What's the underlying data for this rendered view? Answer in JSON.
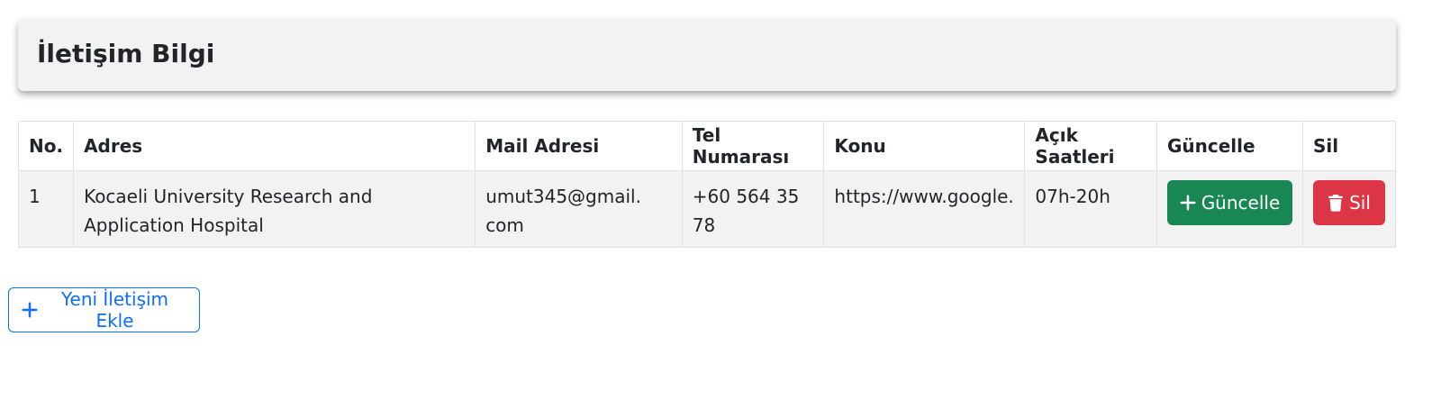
{
  "header": {
    "title": "İletişim Bilgi"
  },
  "table": {
    "columns": [
      "No.",
      "Adres",
      "Mail Adresi",
      "Tel Numarası",
      "Konu",
      "Açık Saatleri",
      "Güncelle",
      "Sil"
    ],
    "rows": [
      {
        "no": "1",
        "adres": "Kocaeli University Research and Application Hospital",
        "mail": "umut345@gmail. com",
        "tel": "+60 564 35 78",
        "konu": "https://www.google.c",
        "acik": "07h-20h",
        "update_label": "Güncelle",
        "delete_label": "Sil"
      }
    ]
  },
  "actions": {
    "add_label": "Yeni İletişim Ekle"
  },
  "icons": {
    "update": "plus-icon",
    "delete": "trash-icon",
    "add": "plus-icon"
  },
  "colors": {
    "success": "#198754",
    "danger": "#dc3545",
    "primary": "#0d6efd"
  }
}
